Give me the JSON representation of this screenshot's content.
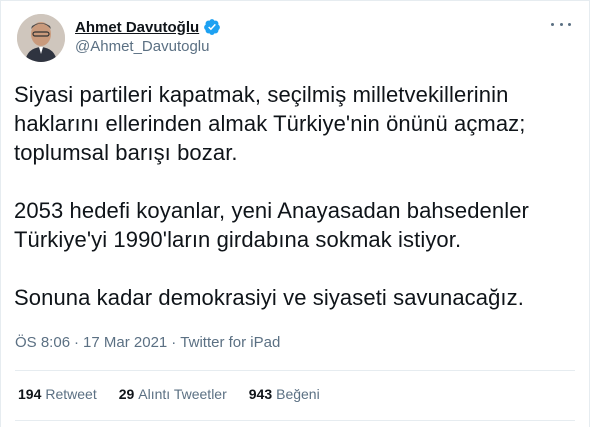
{
  "author": {
    "display_name": "Ahmet Davutoğlu",
    "handle": "@Ahmet_Davutoglu",
    "verified": true
  },
  "tweet": {
    "paragraphs": [
      "Siyasi partileri kapatmak, seçilmiş milletvekillerinin\nhaklarını ellerinden almak Türkiye'nin önünü açmaz;\ntoplumsal barışı bozar.",
      "2053 hedefi koyanlar, yeni Anayasadan bahsedenler\nTürkiye'yi 1990'ların girdabına sokmak istiyor.",
      "Sonuna kadar demokrasiyi ve siyaseti savunacağız."
    ],
    "time": "ÖS 8:06",
    "date": "17 Mar 2021",
    "separator": "·",
    "source": "Twitter for iPad"
  },
  "stats": {
    "retweets": {
      "count": "194",
      "label": "Retweet"
    },
    "quotes": {
      "count": "29",
      "label": "Alıntı Tweetler"
    },
    "likes": {
      "count": "943",
      "label": "Beğeni"
    }
  },
  "colors": {
    "text": "#0f1419",
    "secondary": "#5b7083",
    "verified": "#1da1f2",
    "border": "#e6ecf0"
  },
  "icons": {
    "verified": "verified-badge-icon",
    "more": "more-options-icon"
  }
}
